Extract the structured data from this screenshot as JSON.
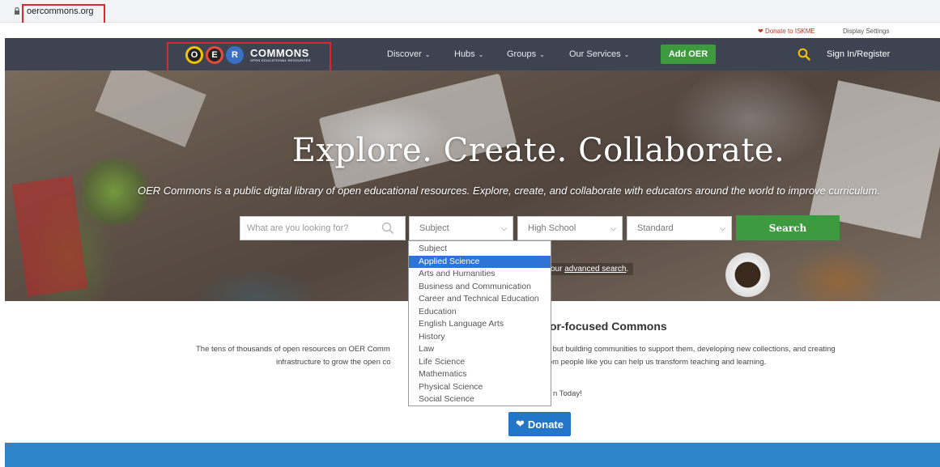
{
  "browser": {
    "url": "oercommons.org"
  },
  "utility": {
    "donate": "Donate to ISKME",
    "display_settings": "Display Settings"
  },
  "nav": {
    "logo_title": "COMMONS",
    "logo_subtitle": "OPEN EDUCATIONAL RESOURCES",
    "logo_letters": [
      "O",
      "E",
      "R"
    ],
    "items": [
      {
        "label": "Discover"
      },
      {
        "label": "Hubs"
      },
      {
        "label": "Groups"
      },
      {
        "label": "Our Services"
      }
    ],
    "add_oer": "Add OER",
    "signin": "Sign In/Register"
  },
  "hero": {
    "title": "Explore. Create. Collaborate.",
    "subtitle": "OER Commons is a public digital library of open educational resources. Explore, create, and collaborate with educators around the world to improve curriculum.",
    "search_placeholder": "What are you looking for?",
    "subject_value": "Subject",
    "level_value": "High School",
    "standard_value": "Standard",
    "search_button": "Search",
    "advanced_prefix": "our",
    "advanced_link": "advanced search"
  },
  "dropdown": {
    "selected_index": 1,
    "options": [
      "Subject",
      "Applied Science",
      "Arts and Humanities",
      "Business and Communication",
      "Career and Technical Education",
      "Education",
      "English Language Arts",
      "History",
      "Law",
      "Life Science",
      "Mathematics",
      "Physical Science",
      "Social Science"
    ]
  },
  "content": {
    "heading_partial": "or-focused Commons",
    "para_line1_left": "The tens of thousands of open resources on OER Comm",
    "para_line1_right": "r - but building communities to support them, developing new collections, and creating",
    "para_line2_left": "infrastructure to grow the open co",
    "para_line2_right": "from people like you can help us transform teaching and learning.",
    "join_partial": "n Today!",
    "donate_button": "Donate"
  },
  "colors": {
    "navbar": "#3d4351",
    "green": "#3e9a3e",
    "blue": "#2275c7",
    "highlight": "#2e73d6",
    "annotation_red": "#e0262f"
  }
}
